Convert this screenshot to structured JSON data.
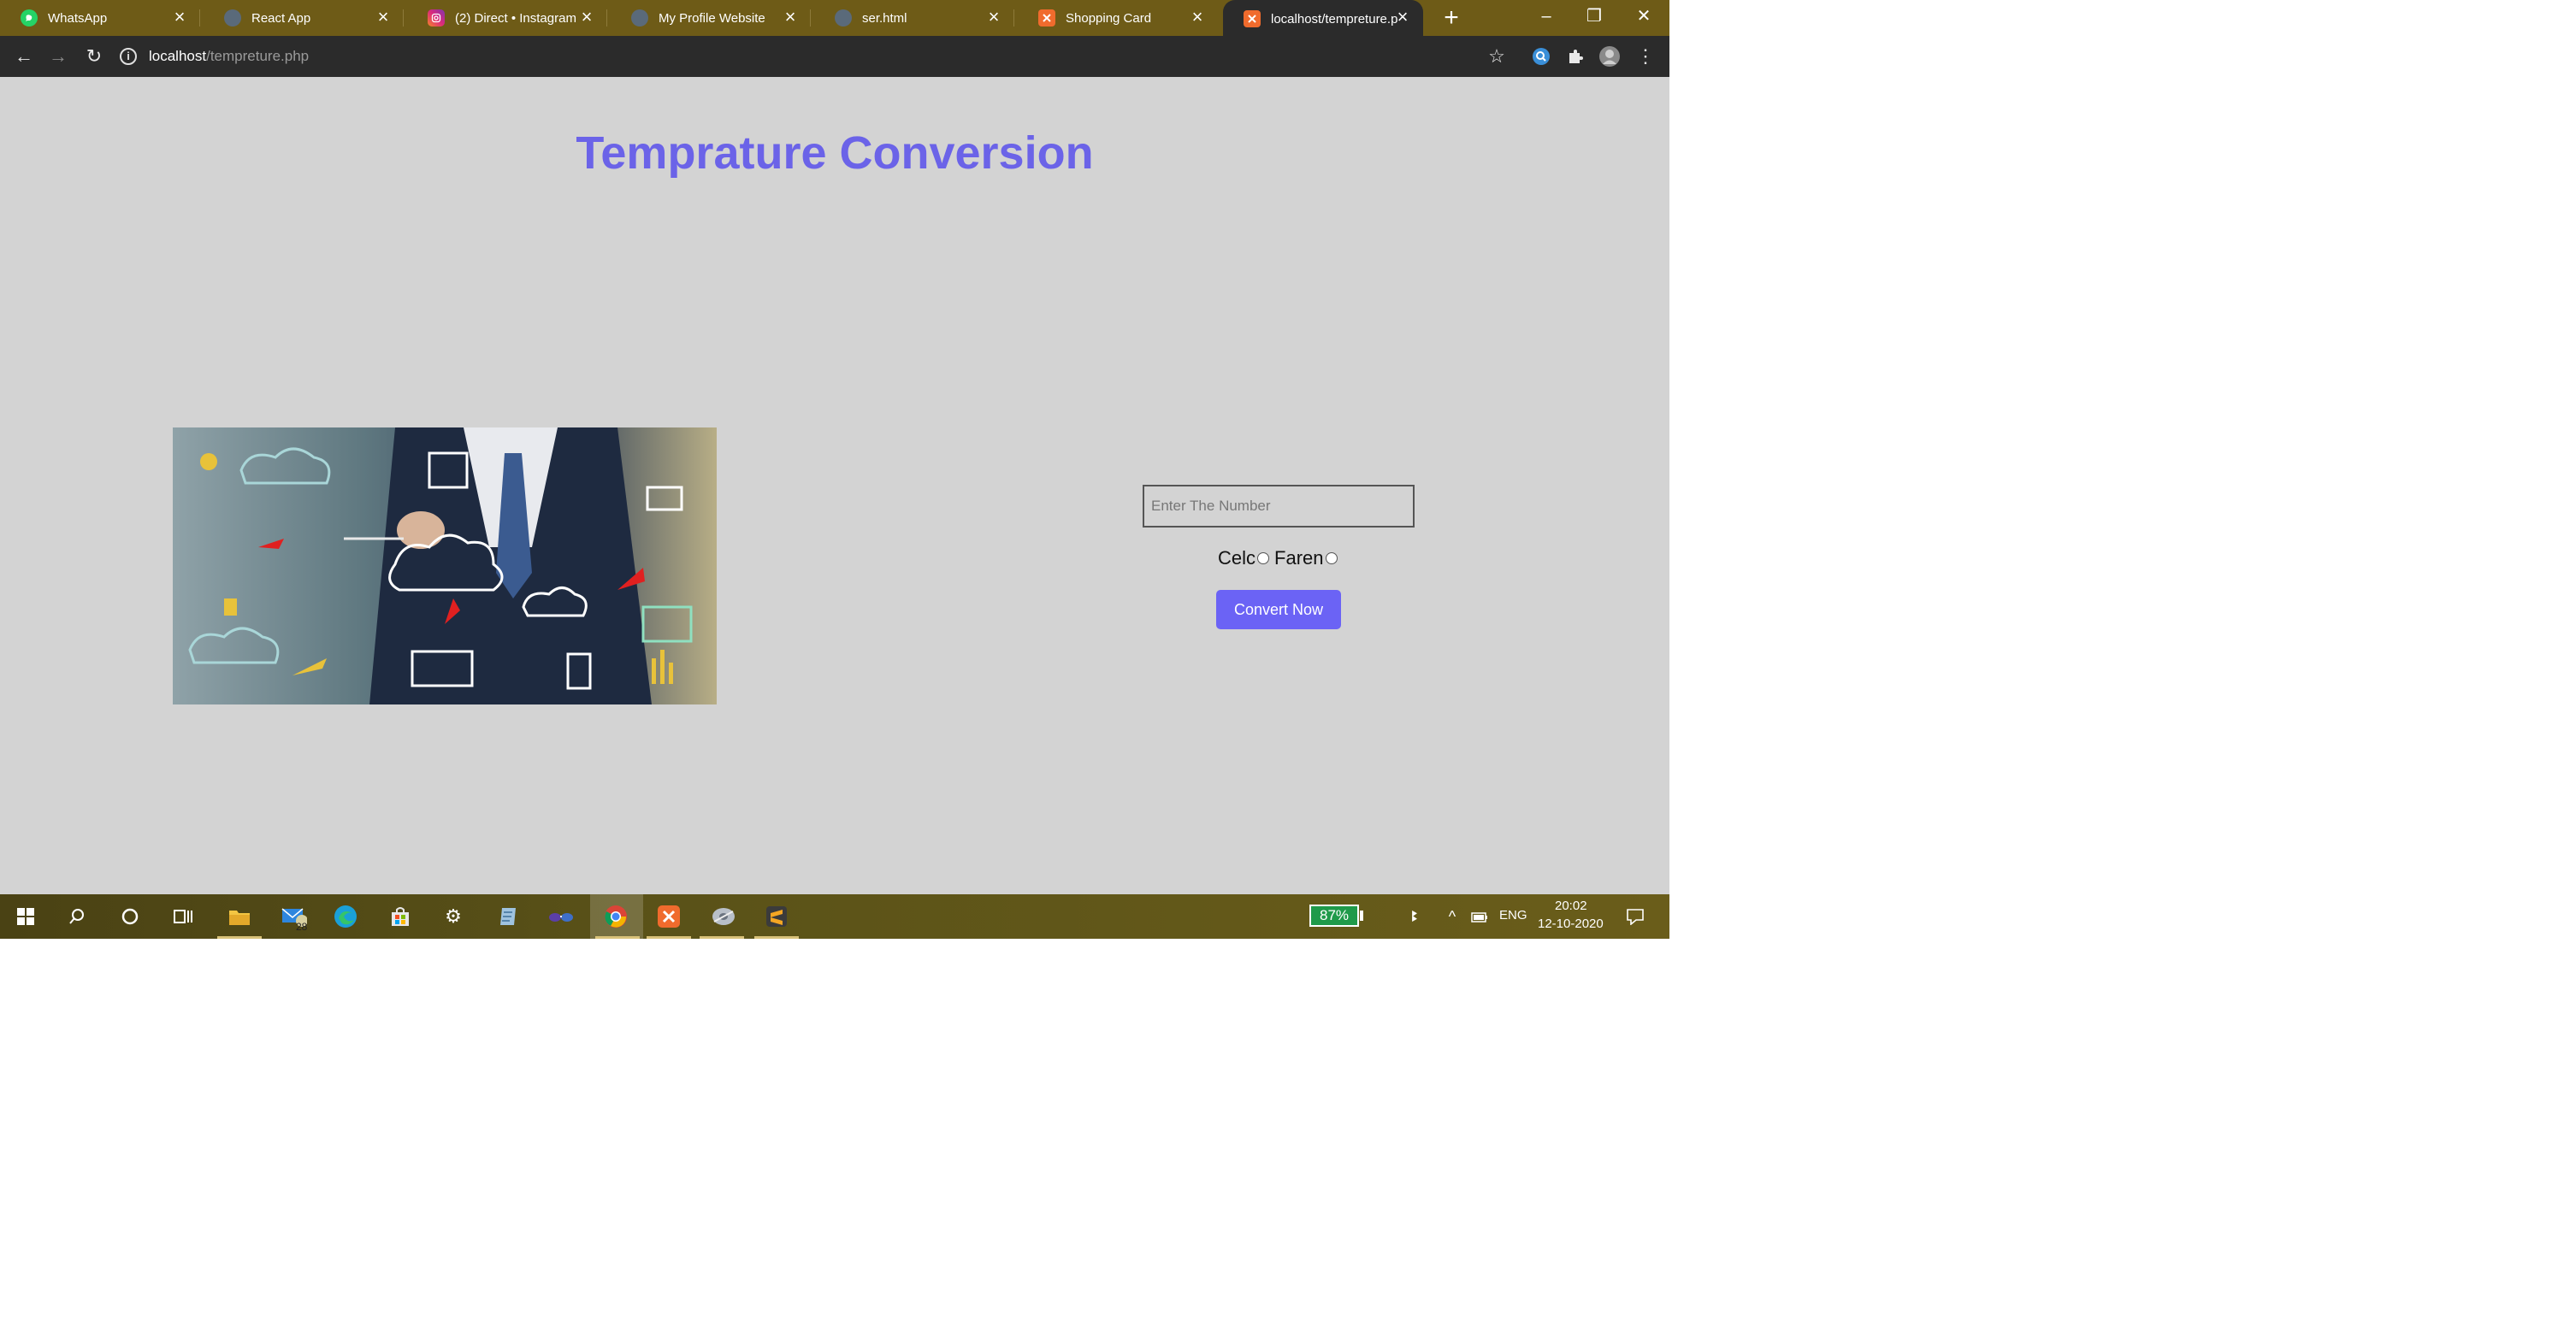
{
  "browser": {
    "tabs": [
      {
        "title": "WhatsApp",
        "icon": "whatsapp-icon",
        "color": "#25d366"
      },
      {
        "title": "React App",
        "icon": "globe-icon",
        "color": "#5a6a7a"
      },
      {
        "title": "(2) Direct • Instagram",
        "icon": "instagram-icon",
        "color": "#e1306c"
      },
      {
        "title": "My Profile Website",
        "icon": "globe-icon",
        "color": "#5a6a7a"
      },
      {
        "title": "ser.html",
        "icon": "globe-icon",
        "color": "#5a6a7a"
      },
      {
        "title": "Shopping Card",
        "icon": "xampp-icon",
        "color": "#f06b2d"
      },
      {
        "title": "localhost/tempreture.p",
        "icon": "xampp-icon",
        "color": "#f06b2d",
        "active": true
      }
    ],
    "url_host": "localhost",
    "url_path": "/tempreture.php"
  },
  "page": {
    "title": "Temprature Conversion",
    "input_placeholder": "Enter The Number",
    "radio_celc_label": "Celc",
    "radio_faren_label": "Faren",
    "convert_label": "Convert Now"
  },
  "taskbar": {
    "battery": "87%",
    "language": "ENG",
    "time": "20:02",
    "date": "12-10-2020",
    "mail_badge": "28"
  }
}
